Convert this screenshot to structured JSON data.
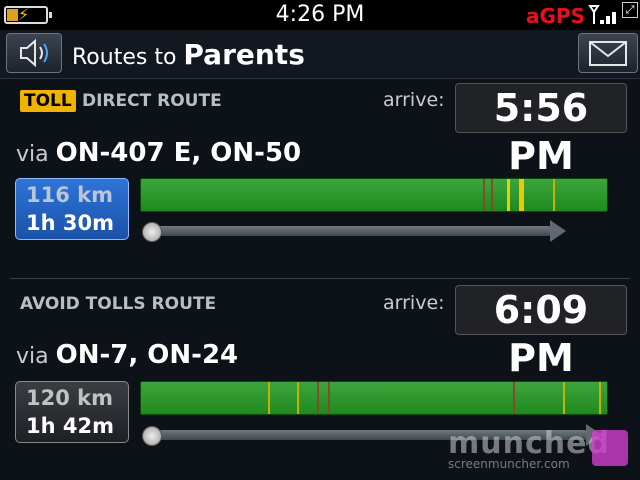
{
  "status": {
    "time": "4:26 PM",
    "gps": "aGPS"
  },
  "header": {
    "prefix": "Routes to",
    "destination": "Parents"
  },
  "routes": [
    {
      "badge": "TOLL",
      "name": "DIRECT ROUTE",
      "arrive_label": "arrive:",
      "arrive_time": "5:56 PM",
      "via_label": "via",
      "via": "ON-407 E, ON-50",
      "distance": "116 km",
      "duration": "1h 30m"
    },
    {
      "badge": "",
      "name": "AVOID TOLLS ROUTE",
      "arrive_label": "arrive:",
      "arrive_time": "6:09 PM",
      "via_label": "via",
      "via": "ON-7, ON-24",
      "distance": "120 km",
      "duration": "1h 42m"
    }
  ],
  "watermark": {
    "big": "munched",
    "small": "screenmuncher.com"
  },
  "icons": [
    "battery-icon",
    "signal-icon",
    "speaker-icon",
    "mail-icon",
    "clock-icon"
  ],
  "colors": {
    "traffic_green": "#2a9a2a",
    "selected_route": "#2368c8",
    "toll_badge": "#f0b400",
    "gps_red": "#e8101a"
  }
}
